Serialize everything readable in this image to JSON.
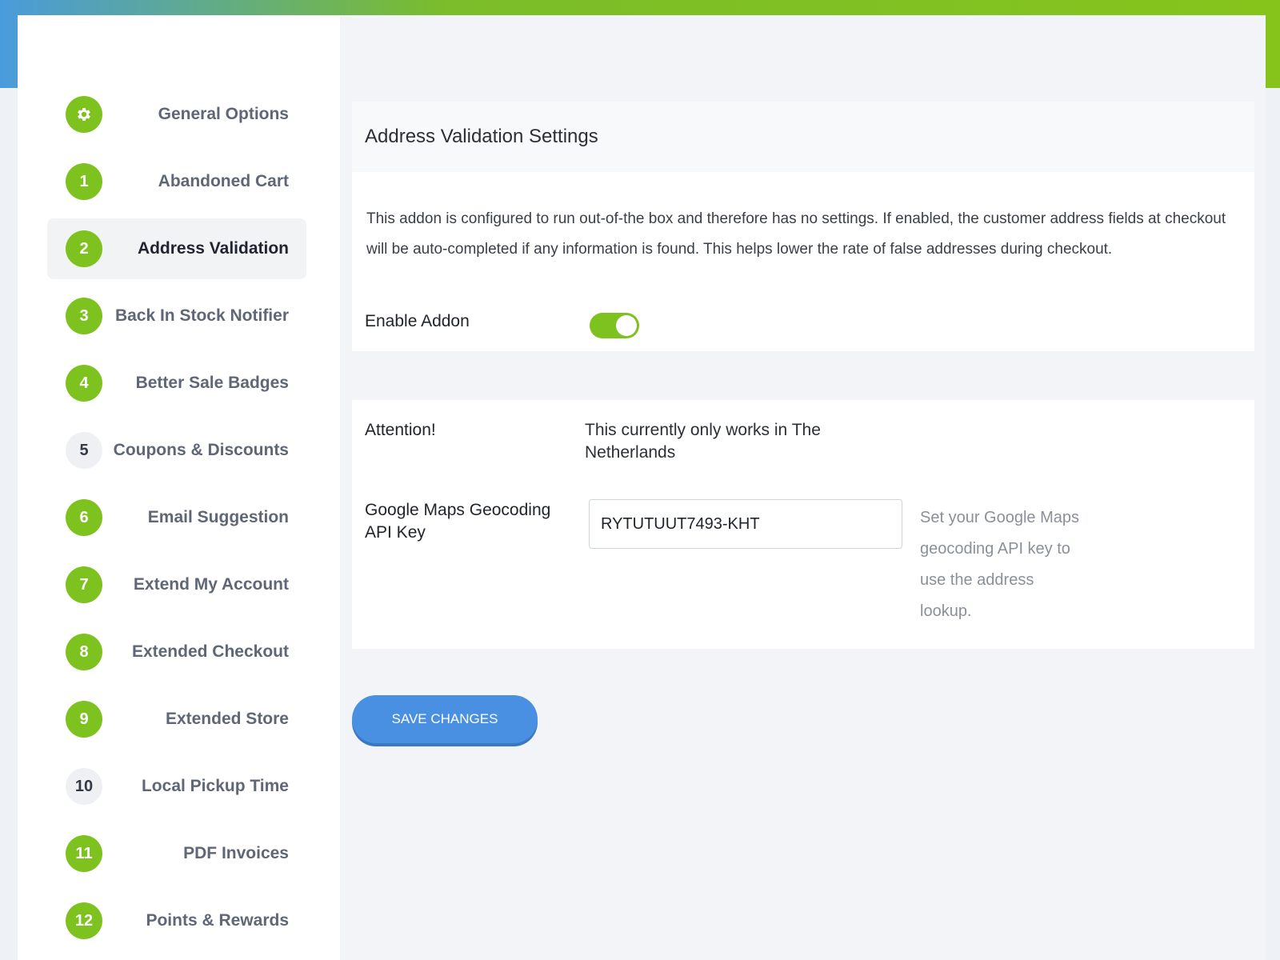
{
  "sidebar": {
    "items": [
      {
        "badge": "",
        "icon": "gear-icon",
        "label": "General Options",
        "active": false,
        "muted": false
      },
      {
        "badge": "1",
        "label": "Abandoned Cart",
        "active": false,
        "muted": false
      },
      {
        "badge": "2",
        "label": "Address Validation",
        "active": true,
        "muted": false
      },
      {
        "badge": "3",
        "label": "Back In Stock Notifier",
        "active": false,
        "muted": false
      },
      {
        "badge": "4",
        "label": "Better Sale Badges",
        "active": false,
        "muted": false
      },
      {
        "badge": "5",
        "label": "Coupons & Discounts",
        "active": false,
        "muted": true
      },
      {
        "badge": "6",
        "label": "Email Suggestion",
        "active": false,
        "muted": false
      },
      {
        "badge": "7",
        "label": "Extend My Account",
        "active": false,
        "muted": false
      },
      {
        "badge": "8",
        "label": "Extended Checkout",
        "active": false,
        "muted": false
      },
      {
        "badge": "9",
        "label": "Extended Store",
        "active": false,
        "muted": false
      },
      {
        "badge": "10",
        "label": "Local Pickup Time",
        "active": false,
        "muted": true
      },
      {
        "badge": "11",
        "label": "PDF Invoices",
        "active": false,
        "muted": false
      },
      {
        "badge": "12",
        "label": "Points & Rewards",
        "active": false,
        "muted": false
      }
    ]
  },
  "settings": {
    "title": "Address Validation Settings",
    "description": "This addon is configured to run out-of-the box and therefore has no settings. If enabled, the customer address fields at checkout will be auto-completed if any information is found. This helps lower the rate of false addresses during checkout.",
    "enable_label": "Enable Addon",
    "enabled": true
  },
  "options": {
    "attention_label": "Attention!",
    "attention_text": "This currently only works in The Netherlands",
    "api_label": "Google Maps Geocoding API Key",
    "api_value": "RYTUTUUT7493-KHT",
    "api_help": "Set your Google Maps geocoding API key to use the address lookup."
  },
  "actions": {
    "save_label": "SAVE CHANGES"
  },
  "colors": {
    "accent_green": "#7ec21f",
    "button_blue": "#4a90e2"
  }
}
